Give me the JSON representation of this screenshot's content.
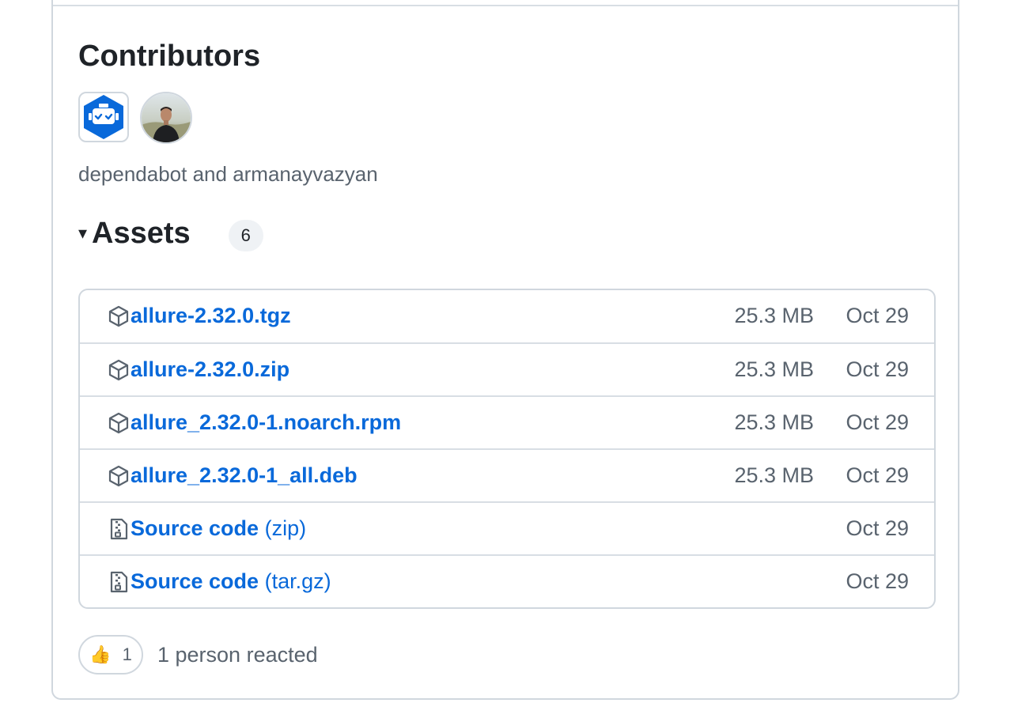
{
  "contributors": {
    "title": "Contributors",
    "avatars": [
      {
        "name": "dependabot",
        "icon": "dependabot-icon"
      },
      {
        "name": "armanayvazyan",
        "icon": "user-avatar"
      }
    ],
    "names_text": "dependabot and armanayvazyan"
  },
  "assets": {
    "caret": "▾",
    "title": "Assets",
    "count": "6",
    "items": [
      {
        "name": "allure-2.32.0.tgz",
        "suffix": "",
        "size": "25.3 MB",
        "date": "Oct 29",
        "icon": "package-icon"
      },
      {
        "name": "allure-2.32.0.zip",
        "suffix": "",
        "size": "25.3 MB",
        "date": "Oct 29",
        "icon": "package-icon"
      },
      {
        "name": "allure_2.32.0-1.noarch.rpm",
        "suffix": "",
        "size": "25.3 MB",
        "date": "Oct 29",
        "icon": "package-icon"
      },
      {
        "name": "allure_2.32.0-1_all.deb",
        "suffix": "",
        "size": "25.3 MB",
        "date": "Oct 29",
        "icon": "package-icon"
      },
      {
        "name": "Source code",
        "suffix": "(zip)",
        "size": "",
        "date": "Oct 29",
        "icon": "file-zip-icon"
      },
      {
        "name": "Source code",
        "suffix": "(tar.gz)",
        "size": "",
        "date": "Oct 29",
        "icon": "file-zip-icon"
      }
    ]
  },
  "reactions": {
    "emoji": "👍",
    "count": "1",
    "summary": "1 person reacted"
  },
  "colors": {
    "link": "#0969da",
    "muted": "#59636e",
    "border": "#d0d7de",
    "dependabot_blue": "#0969da"
  }
}
